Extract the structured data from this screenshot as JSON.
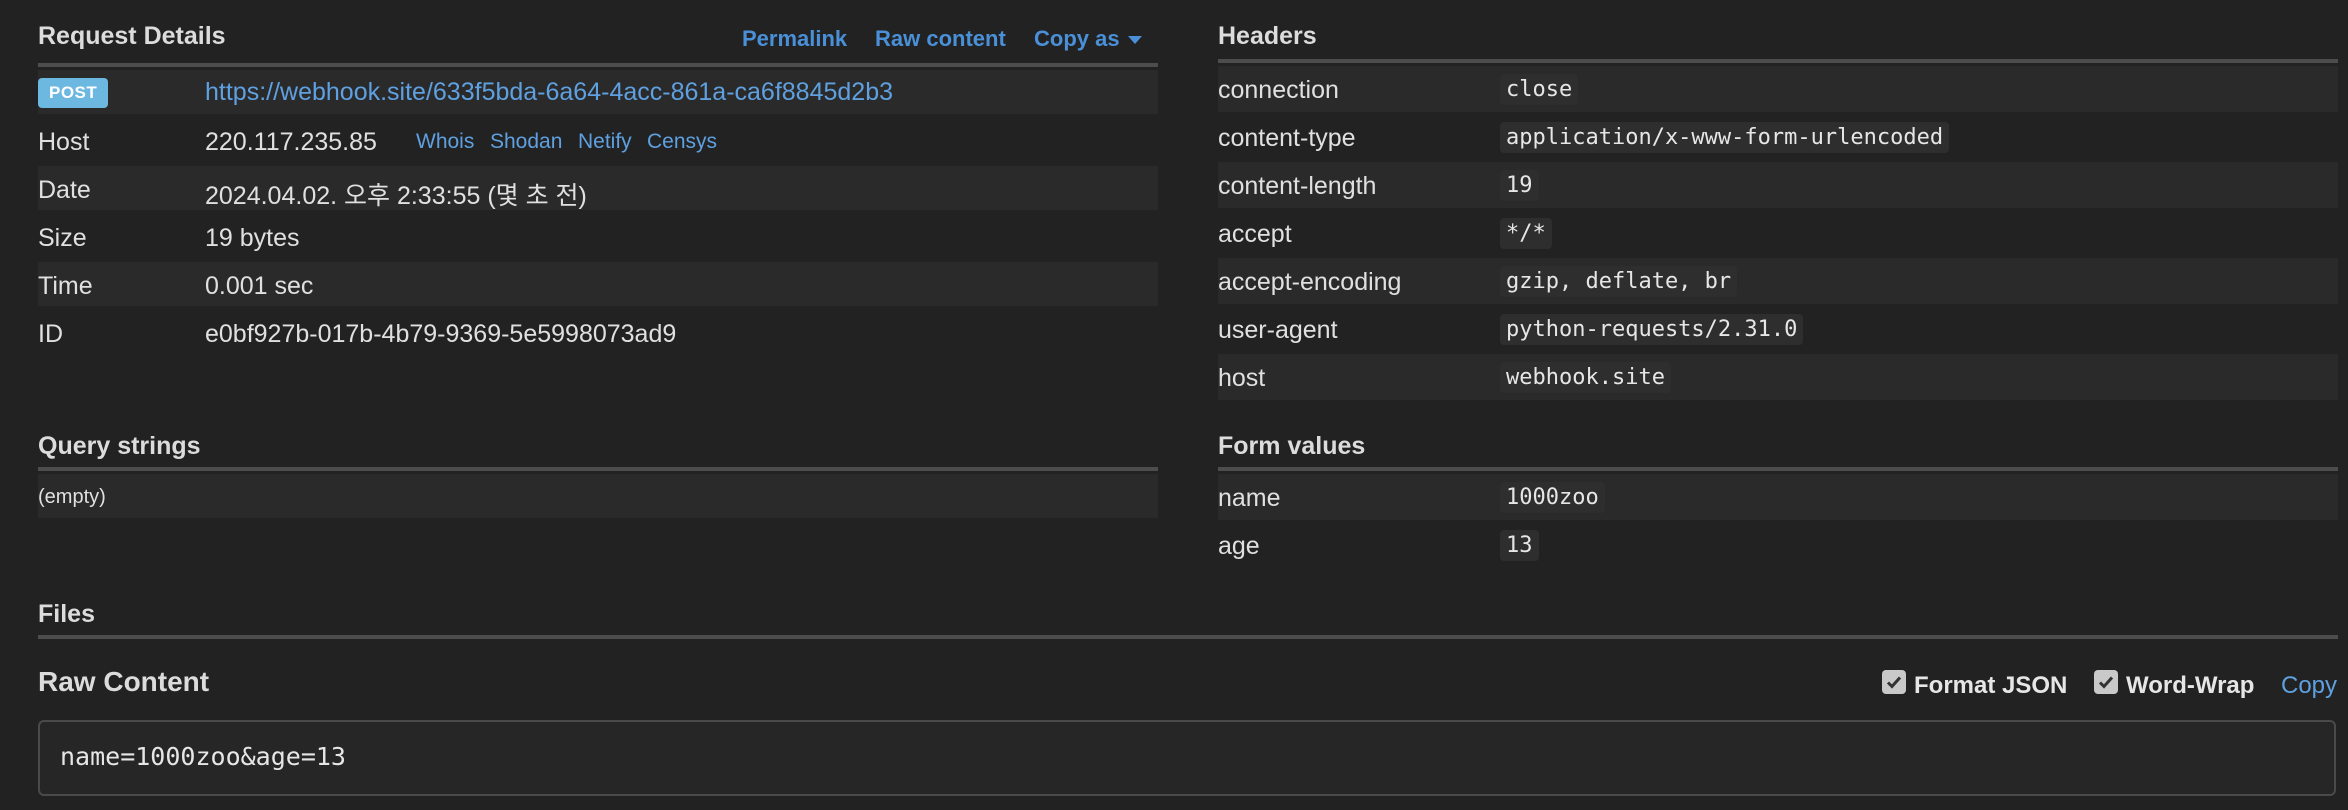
{
  "request_details": {
    "title": "Request Details",
    "links": {
      "permalink": "Permalink",
      "raw_content": "Raw content",
      "copy_as": "Copy as"
    },
    "method": "POST",
    "url": "https://webhook.site/633f5bda-6a64-4acc-861a-ca6f8845d2b3",
    "host_label": "Host",
    "host_value": "220.117.235.85",
    "host_links": [
      "Whois",
      "Shodan",
      "Netify",
      "Censys"
    ],
    "date_label": "Date",
    "date_value": "2024.04.02. 오후 2:33:55 (몇 초 전)",
    "size_label": "Size",
    "size_value": "19 bytes",
    "time_label": "Time",
    "time_value": "0.001 sec",
    "id_label": "ID",
    "id_value": "e0bf927b-017b-4b79-9369-5e5998073ad9"
  },
  "headers": {
    "title": "Headers",
    "rows": [
      {
        "name": "connection",
        "value": "close"
      },
      {
        "name": "content-type",
        "value": "application/x-www-form-urlencoded"
      },
      {
        "name": "content-length",
        "value": "19"
      },
      {
        "name": "accept",
        "value": "*/*"
      },
      {
        "name": "accept-encoding",
        "value": "gzip, deflate, br"
      },
      {
        "name": "user-agent",
        "value": "python-requests/2.31.0"
      },
      {
        "name": "host",
        "value": "webhook.site"
      }
    ]
  },
  "query_strings": {
    "title": "Query strings",
    "empty_text": "(empty)"
  },
  "form_values": {
    "title": "Form values",
    "rows": [
      {
        "name": "name",
        "value": "1000zoo"
      },
      {
        "name": "age",
        "value": "13"
      }
    ]
  },
  "files": {
    "title": "Files"
  },
  "raw_content": {
    "title": "Raw Content",
    "format_json_label": "Format JSON",
    "format_json_checked": true,
    "word_wrap_label": "Word-Wrap",
    "word_wrap_checked": true,
    "copy_label": "Copy",
    "body": "name=1000zoo&age=13"
  },
  "colors": {
    "background": "#222222",
    "link": "#5fa0e0",
    "badge": "#6cb8e0",
    "rule": "#4d4d4d"
  }
}
